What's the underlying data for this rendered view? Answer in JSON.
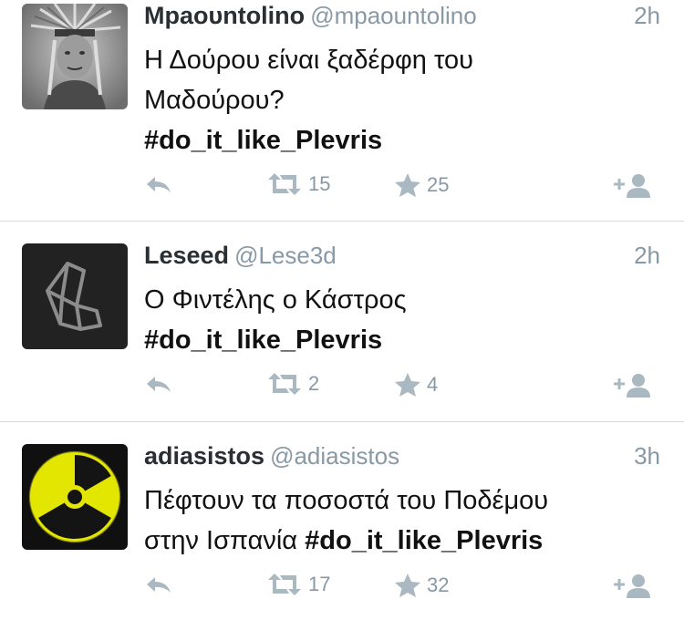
{
  "tweets": [
    {
      "name": "Μpaoυntolino",
      "handle": "@mpaountolino",
      "time": "2h",
      "text_lines": [
        "Η Δούρου είναι ξαδέρφη του",
        "Μαδούρου?"
      ],
      "hashtag": "#do_it_like_Plevris",
      "retweets": "15",
      "favorites": "25",
      "avatar_icon": "native-headdress-photo"
    },
    {
      "name": "Leseed",
      "handle": "@Lese3d",
      "time": "2h",
      "text_lines": [
        "Ο Φιντέλης ο Κάστρος"
      ],
      "hashtag": "#do_it_like_Plevris",
      "retweets": "2",
      "favorites": "4",
      "avatar_icon": "geometric-logo"
    },
    {
      "name": "adiasistos",
      "handle": "@adiasistos",
      "time": "3h",
      "text_lines": [
        "Πέφτουν τα ποσοστά του Ποδέμου",
        "στην Ισπανία"
      ],
      "hashtag": "#do_it_like_Plevris",
      "retweets": "17",
      "favorites": "32",
      "avatar_icon": "radiation-symbol"
    }
  ],
  "colors": {
    "name": "#292f33",
    "meta": "#8899a6",
    "icon": "#aab8c2",
    "separator": "#d9dde1"
  }
}
